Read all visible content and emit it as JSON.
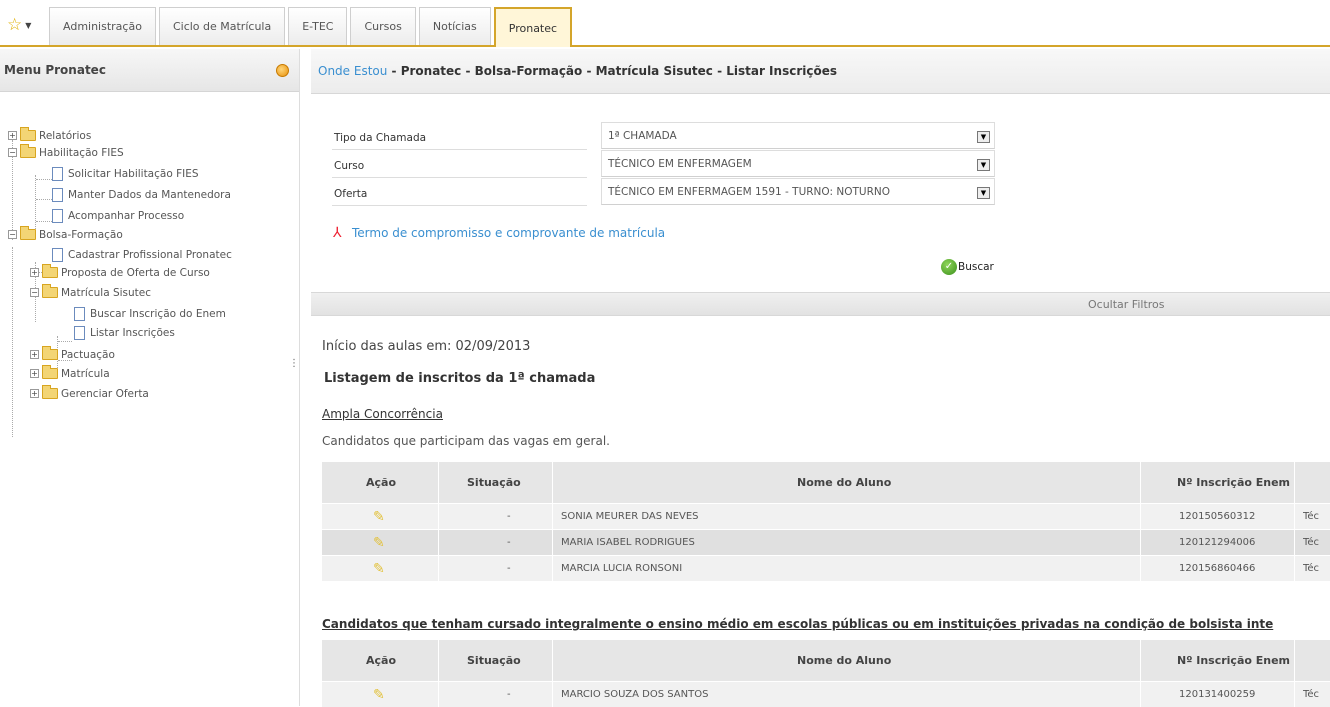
{
  "tabs": [
    "Administração",
    "Ciclo de Matrícula",
    "E-TEC",
    "Cursos",
    "Notícias",
    "Pronatec"
  ],
  "sidebar": {
    "title": "Menu Pronatec",
    "items": [
      {
        "label": "Relatórios"
      },
      {
        "label": "Habilitação FIES"
      },
      {
        "label": "Solicitar Habilitação FIES"
      },
      {
        "label": "Manter Dados da Mantenedora"
      },
      {
        "label": "Acompanhar Processo"
      },
      {
        "label": "Bolsa-Formação"
      },
      {
        "label": "Cadastrar Profissional Pronatec"
      },
      {
        "label": "Proposta de Oferta de Curso"
      },
      {
        "label": "Matrícula Sisutec"
      },
      {
        "label": "Buscar Inscrição do Enem"
      },
      {
        "label": "Listar Inscrições"
      },
      {
        "label": "Pactuação"
      },
      {
        "label": "Matrícula"
      },
      {
        "label": "Gerenciar Oferta"
      }
    ]
  },
  "breadcrumb": {
    "link": "Onde Estou",
    "path": " - Pronatec - Bolsa-Formação - Matrícula Sisutec - Listar Inscrições"
  },
  "filters": [
    {
      "label": "Tipo da Chamada",
      "value": "1ª CHAMADA"
    },
    {
      "label": "Curso",
      "value": "TÉCNICO EM ENFERMAGEM"
    },
    {
      "label": "Oferta",
      "value": "TÉCNICO EM ENFERMAGEM 1591 - TURNO: NOTURNO"
    }
  ],
  "pdf_link": "Termo de compromisso e comprovante de matrícula",
  "buscar": "Buscar",
  "ocultar": "Ocultar Filtros",
  "inicio": "Início das aulas em: 02/09/2013",
  "listagem": "Listagem de inscritos da 1ª chamada",
  "ampla": "Ampla Concorrência",
  "cand_desc": "Candidatos que participam das vagas em geral.",
  "table_headers": {
    "acao": "Ação",
    "situacao": "Situação",
    "nome": "Nome do Aluno",
    "inscricao": "Nº Inscrição Enem"
  },
  "rows1": [
    {
      "situacao": "-",
      "nome": "SONIA MEURER DAS NEVES",
      "inscricao": "120150560312",
      "extra": "Téc"
    },
    {
      "situacao": "-",
      "nome": "MARIA ISABEL RODRIGUES",
      "inscricao": "120121294006",
      "extra": "Téc"
    },
    {
      "situacao": "-",
      "nome": "MARCIA LUCIA RONSONI",
      "inscricao": "120156860466",
      "extra": "Téc"
    }
  ],
  "escolas_heading": "Candidatos que tenham cursado integralmente o ensino médio em escolas públicas ou em instituições privadas na condição de bolsista inte",
  "rows2": [
    {
      "situacao": "-",
      "nome": "MARCIO SOUZA DOS SANTOS",
      "inscricao": "120131400259",
      "extra": "Téc"
    }
  ]
}
